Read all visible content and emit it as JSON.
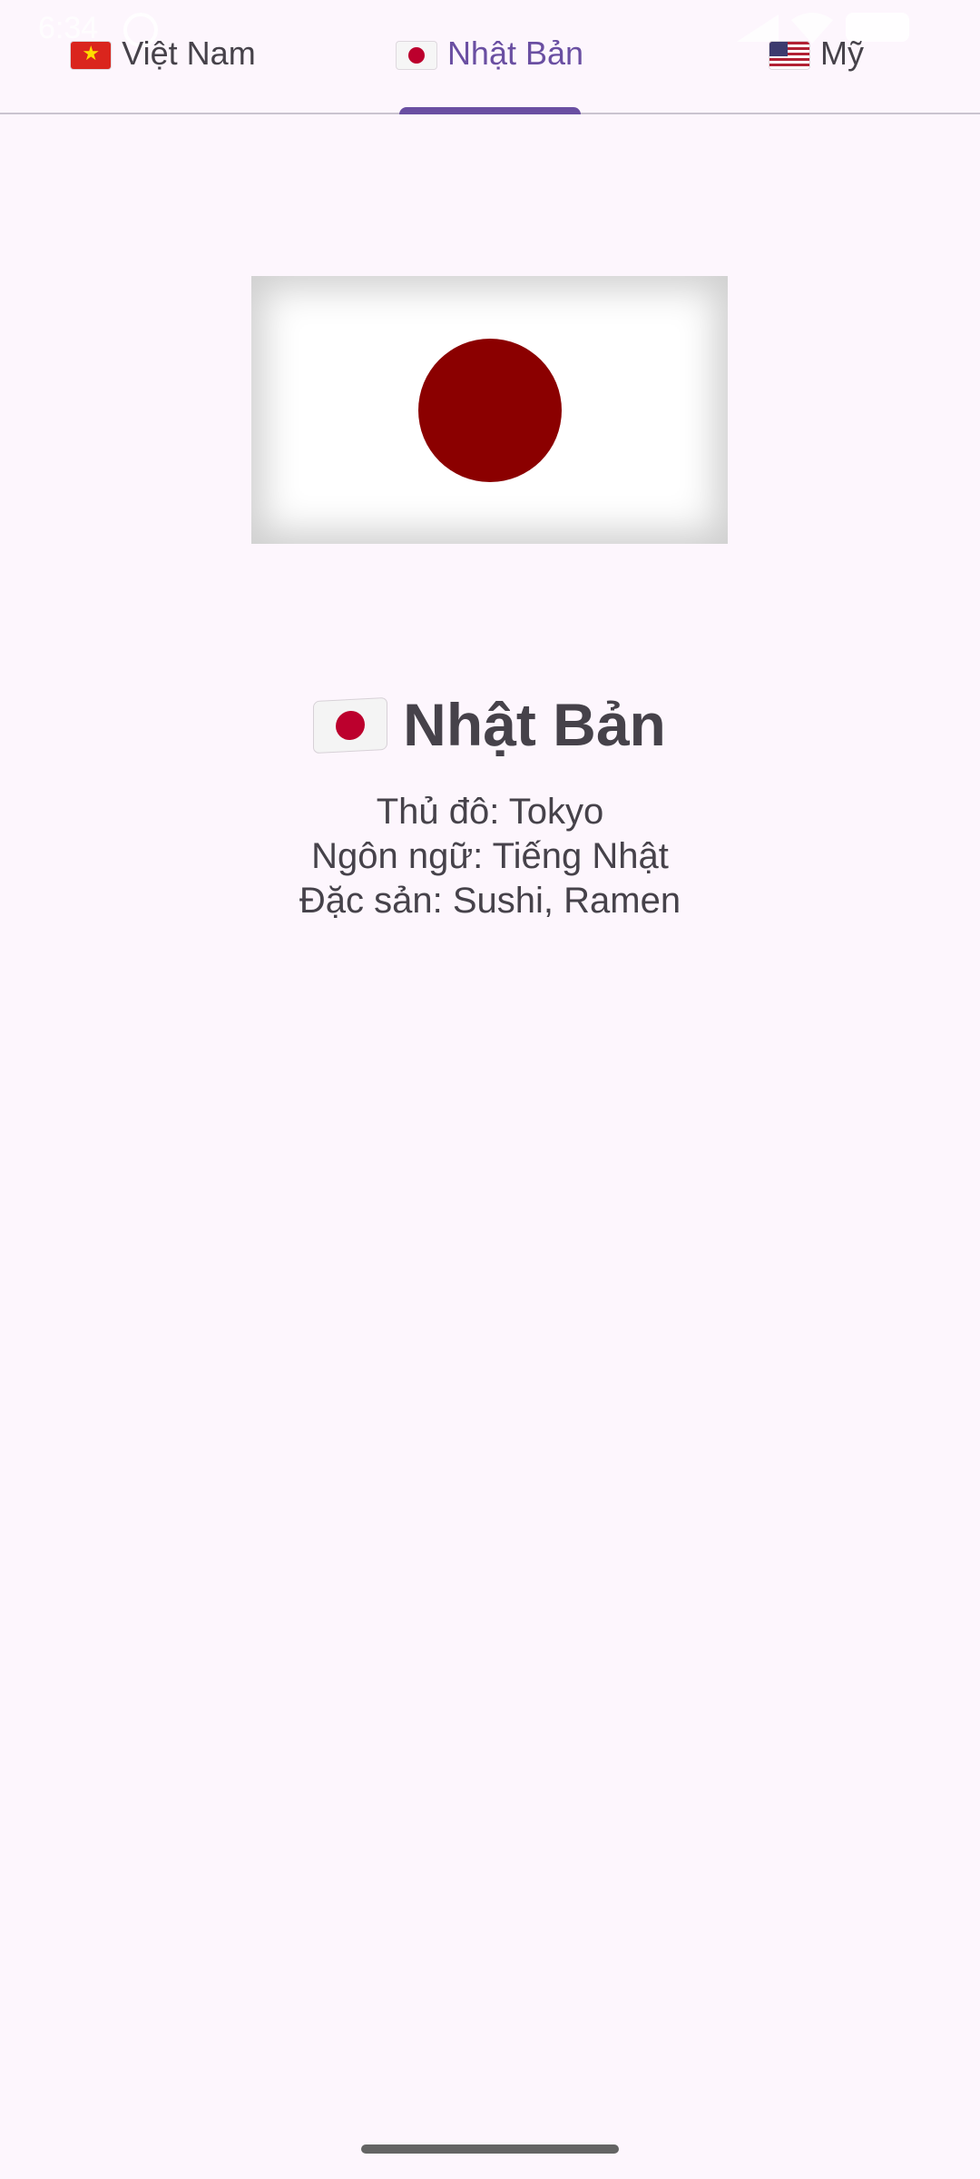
{
  "status_bar": {
    "time": "6:34"
  },
  "tabs": [
    {
      "label": "Việt Nam",
      "flag_icon": "vietnam-flag-icon",
      "active": false
    },
    {
      "label": "Nhật Bản",
      "flag_icon": "japan-flag-icon",
      "active": true
    },
    {
      "label": "Mỹ",
      "flag_icon": "usa-flag-icon",
      "active": false
    }
  ],
  "country": {
    "name": "Nhật Bản",
    "flag_icon": "japan-flag-icon",
    "capital_line": "Thủ đô: Tokyo",
    "language_line": "Ngôn ngữ: Tiếng Nhật",
    "specialty_line": "Đặc sản: Sushi, Ramen"
  },
  "colors": {
    "background": "#fdf6fd",
    "accent": "#6a4fa2",
    "text": "#46424a",
    "flag_sun": "#8b0000"
  }
}
